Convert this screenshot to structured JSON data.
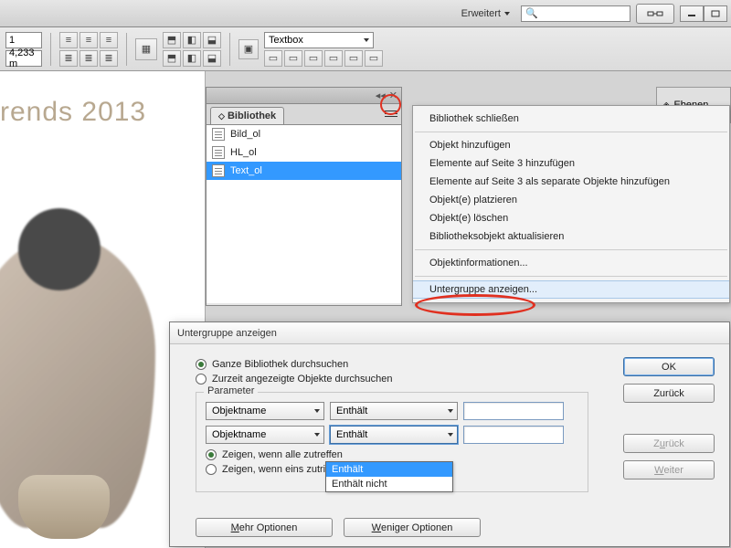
{
  "topbar": {
    "mode_label": "Erweitert",
    "search_placeholder": ""
  },
  "toolbar": {
    "count_value": "1",
    "measure_value": "4,233 m",
    "style_select": "Textbox"
  },
  "canvas": {
    "headline": "rends 2013"
  },
  "library": {
    "tab_label": "Bibliothek",
    "items": [
      {
        "label": "Bild_ol",
        "selected": false
      },
      {
        "label": "HL_ol",
        "selected": false
      },
      {
        "label": "Text_ol",
        "selected": true
      }
    ]
  },
  "right_dock": {
    "ebenen_label": "Ebenen"
  },
  "context_menu": {
    "items": [
      "Bibliothek schließen",
      "-",
      "Objekt hinzufügen",
      "Elemente auf Seite 3 hinzufügen",
      "Elemente auf Seite 3 als separate Objekte hinzufügen",
      "Objekt(e) platzieren",
      "Objekt(e) löschen",
      "Bibliotheksobjekt aktualisieren",
      "-",
      "Objektinformationen...",
      "-",
      "Untergruppe anzeigen..."
    ],
    "hover_index": 11
  },
  "dialog": {
    "title": "Untergruppe anzeigen",
    "radio1": "Ganze Bibliothek durchsuchen",
    "radio2": "Zurzeit angezeigte Objekte durchsuchen",
    "radio1_checked": true,
    "fieldset_label": "Parameter",
    "param_name": "Objektname",
    "operator": "Enthält",
    "dd_options": [
      "Enthält",
      "Enthält nicht"
    ],
    "dd_selected_index": 0,
    "show_all": "Zeigen, wenn alle zutreffen",
    "show_one": "Zeigen, wenn eins zutrifft",
    "show_all_checked": true,
    "ok": "OK",
    "back": "Zurück",
    "back2_label_pre": "Z",
    "back2_label_u": "u",
    "back2_label_post": "rück",
    "fwd_label_pre": "",
    "fwd_label_u": "W",
    "fwd_label_post": "eiter",
    "more_pre": "",
    "more_u": "M",
    "more_post": "ehr Optionen",
    "less_pre": "",
    "less_u": "W",
    "less_post": "eniger Optionen"
  }
}
